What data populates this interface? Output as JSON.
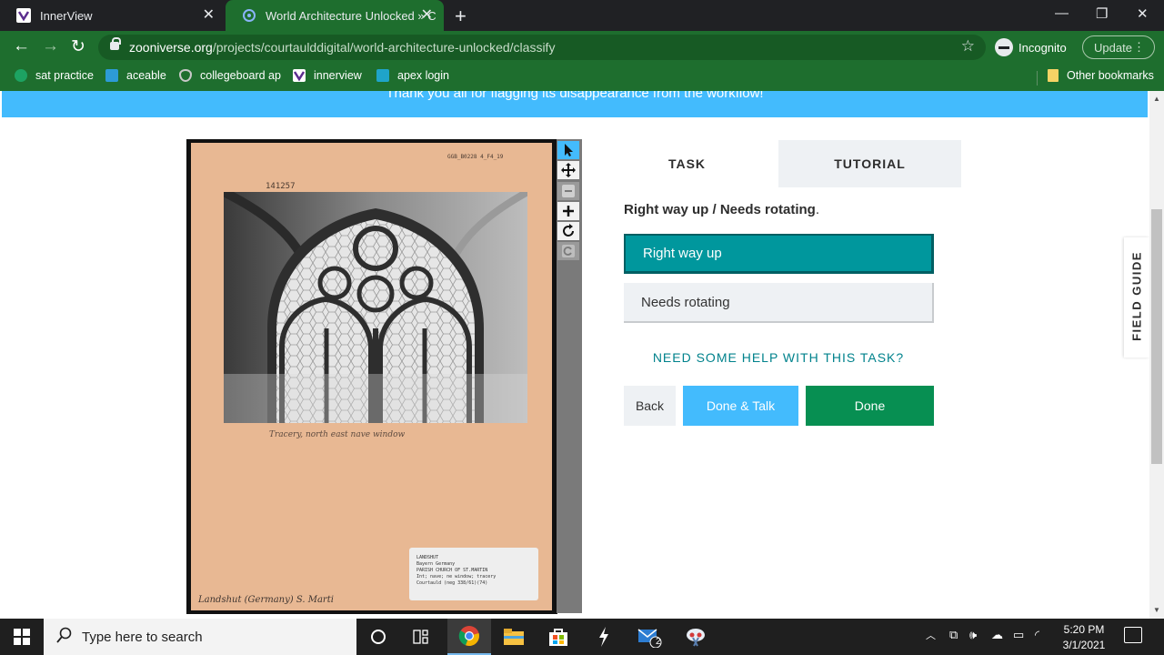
{
  "browser": {
    "tabs": [
      {
        "title": "InnerView"
      },
      {
        "title": "World Architecture Unlocked » C"
      }
    ],
    "new_tab": "+",
    "url_domain": "zooniverse.org",
    "url_path": "/projects/courtaulddigital/world-architecture-unlocked/classify",
    "profile": "Incognito",
    "update_label": "Update",
    "bookmarks": [
      {
        "label": "sat practice",
        "icon": "sat-practice-icon",
        "color": "#1da362"
      },
      {
        "label": "aceable",
        "icon": "aceable-icon",
        "color": "#2d9bd6"
      },
      {
        "label": "collegeboard ap",
        "icon": "collegeboard-icon",
        "color": "#555555"
      },
      {
        "label": "innerview",
        "icon": "innerview-icon",
        "color": "#5b2d8e"
      },
      {
        "label": "apex login",
        "icon": "apex-icon",
        "color": "#1fa4c9"
      }
    ],
    "other_bookmarks": "Other bookmarks"
  },
  "page": {
    "banner_text": "Thank you all for flagging its disappearance from the workflow!",
    "subject": {
      "card_number_left": "141257",
      "card_number_right": "GGB_B0228 4_F4_19",
      "caption": "Tracery, north east nave window",
      "signature": "Landshut (Germany) S. Marti",
      "label_lines": [
        "LANDSHUT",
        "Bayern Germany",
        "PARISH CHURCH OF ST.MARTIN",
        "Int; nave; ne window; tracery",
        "Courtauld (neg 338/61)(74)"
      ]
    },
    "tabs": {
      "task": "TASK",
      "tutorial": "TUTORIAL"
    },
    "question": "Right way up / Needs rotating",
    "question_end": ".",
    "answers": [
      "Right way up",
      "Needs rotating"
    ],
    "help": "NEED SOME HELP WITH THIS TASK?",
    "buttons": {
      "back": "Back",
      "done_talk": "Done & Talk",
      "done": "Done"
    },
    "field_guide": "FIELD GUIDE",
    "colors": {
      "banner": "#43bbfd",
      "selected_answer": "#00979d",
      "done": "#078f52",
      "done_talk": "#43bbfd",
      "browser_frame": "#1e6e2e"
    }
  },
  "taskbar": {
    "search_placeholder": "Type here to search",
    "mail_badge": "2",
    "time": "5:20 PM",
    "date": "3/1/2021"
  }
}
